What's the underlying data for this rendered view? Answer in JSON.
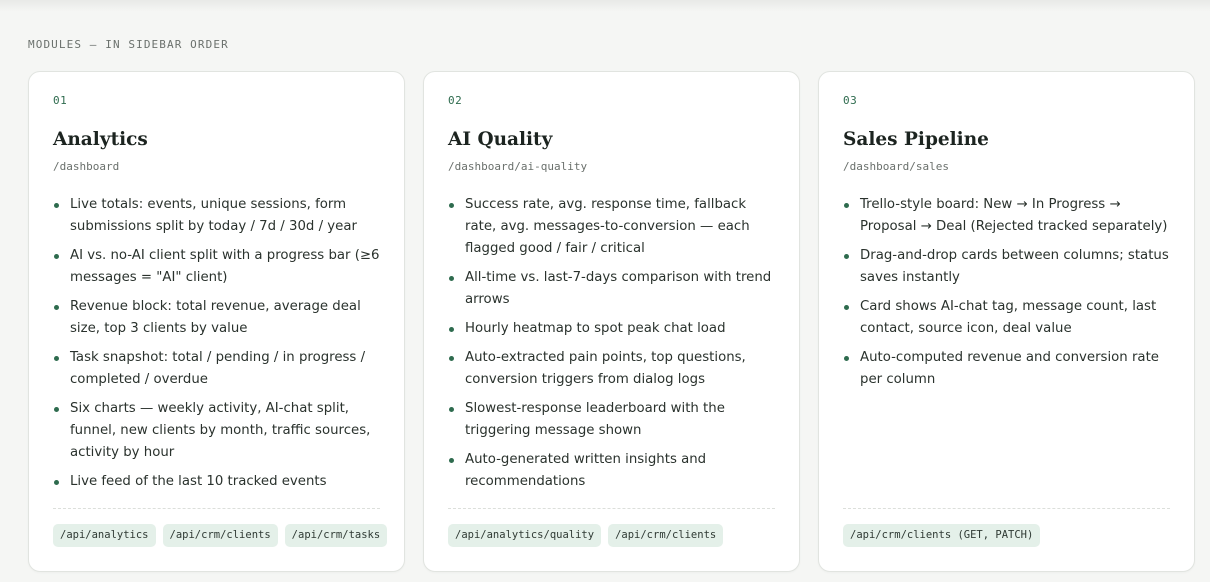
{
  "section": {
    "label": "MODULES — IN SIDEBAR ORDER"
  },
  "modules": [
    {
      "number": "01",
      "title": "Analytics",
      "path": "/dashboard",
      "features": [
        "Live totals: events, unique sessions, form submissions split by today / 7d / 30d / year",
        "AI vs. no-AI client split with a progress bar (≥6 messages = \"AI\" client)",
        "Revenue block: total revenue, average deal size, top 3 clients by value",
        "Task snapshot: total / pending / in progress / completed / overdue",
        "Six charts — weekly activity, AI-chat split, funnel, new clients by month, traffic sources, activity by hour",
        "Live feed of the last 10 tracked events"
      ],
      "endpoints": [
        "/api/analytics",
        "/api/crm/clients",
        "/api/crm/tasks"
      ]
    },
    {
      "number": "02",
      "title": "AI Quality",
      "path": "/dashboard/ai-quality",
      "features": [
        "Success rate, avg. response time, fallback rate, avg. messages-to-conversion — each flagged good / fair / critical",
        "All-time vs. last-7-days comparison with trend arrows",
        "Hourly heatmap to spot peak chat load",
        "Auto-extracted pain points, top questions, conversion triggers from dialog logs",
        "Slowest-response leaderboard with the triggering message shown",
        "Auto-generated written insights and recommendations"
      ],
      "endpoints": [
        "/api/analytics/quality",
        "/api/crm/clients"
      ]
    },
    {
      "number": "03",
      "title": "Sales Pipeline",
      "path": "/dashboard/sales",
      "features": [
        "Trello-style board: New → In Progress → Proposal → Deal (Rejected tracked separately)",
        "Drag-and-drop cards between columns; status saves instantly",
        "Card shows AI-chat tag, message count, last contact, source icon, deal value",
        "Auto-computed revenue and conversion rate per column"
      ],
      "endpoints": [
        "/api/crm/clients (GET, PATCH)"
      ]
    }
  ]
}
